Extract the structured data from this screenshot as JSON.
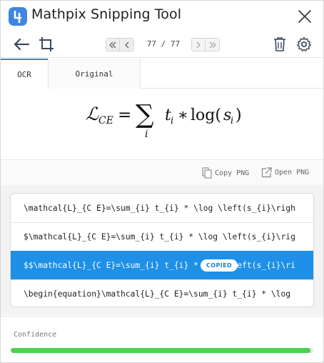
{
  "app": {
    "title": "Mathpix Snipping Tool",
    "logo_icon": "mathpix-logo-icon",
    "accent_color": "#1e90e8"
  },
  "toolbar": {
    "page_counter": "77 / 77",
    "current_page": 77,
    "total_pages": 77
  },
  "tabs": [
    {
      "label": "OCR",
      "active": true
    },
    {
      "label": "Original",
      "active": false
    }
  ],
  "formula": {
    "latex": "\\mathcal{L}_{CE}=\\sum_{i} t_{i} * \\log(s_{i})"
  },
  "actions": {
    "copy_png": "Copy PNG",
    "open_png": "Open PNG"
  },
  "results": [
    {
      "text": "\\mathcal{L}_{C E}=\\sum_{i} t_{i} * \\log \\left(s_{i}\\righ",
      "selected": false
    },
    {
      "text": "$\\mathcal{L}_{C E}=\\sum_{i} t_{i} * \\log \\left(s_{i}\\rig",
      "selected": false
    },
    {
      "text": "$$\\mathcal{L}_{C E}=\\sum_{i} t_{i} * \\log \\left(s_{i}\\ri",
      "selected": true
    },
    {
      "text": "\\begin{equation}\\mathcal{L}_{C E}=\\sum_{i} t_{i} * \\log",
      "selected": false
    }
  ],
  "copied_badge": "COPIED",
  "confidence": {
    "label": "Confidence",
    "value": 0.99,
    "color": "#4cd14c"
  }
}
